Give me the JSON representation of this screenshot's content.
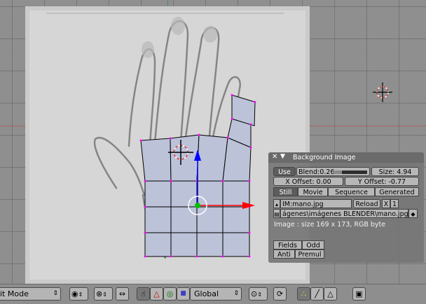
{
  "colors": {
    "viewport_bg": "#8f8f8f",
    "mesh_fill": "#bcc2d8",
    "selected_vertex": "#ff00ff",
    "axis_x_arrow": "#ff0000",
    "axis_z_arrow": "#0000ff",
    "panel_bg": "#767676"
  },
  "bg_panel": {
    "title": "Background Image",
    "use_label": "Use",
    "blend_label": "Blend:0.26",
    "blend_value": 0.26,
    "size_label": "Size: 4.94",
    "x_offset_label": "X Offset: 0.00",
    "y_offset_label": "Y Offset: -0.77",
    "tabs": [
      "Still",
      "Movie",
      "Sequence",
      "Generated"
    ],
    "image_name": "IM:mano.jpg",
    "reload_label": "Reload",
    "close_label": "X",
    "users_label": "1",
    "file_path": "ágenes\\imágenes BLENDER\\mano.jpg",
    "image_info": "Image : size 169 x 173, RGB byte",
    "fields_label": "Fields",
    "odd_label": "Odd",
    "anti_label": "Anti",
    "premul_label": "Premul"
  },
  "header": {
    "mode_label": "it Mode",
    "orientation_label": "Global",
    "icons": [
      "view-menu-icon",
      "pivot-icon",
      "proportional-icon",
      "manipulator-hand-icon",
      "translate-icon",
      "rotate-icon",
      "scale-icon",
      "snap-icon",
      "vertex-select-icon",
      "edge-select-icon",
      "face-select-icon",
      "render-icon"
    ]
  }
}
